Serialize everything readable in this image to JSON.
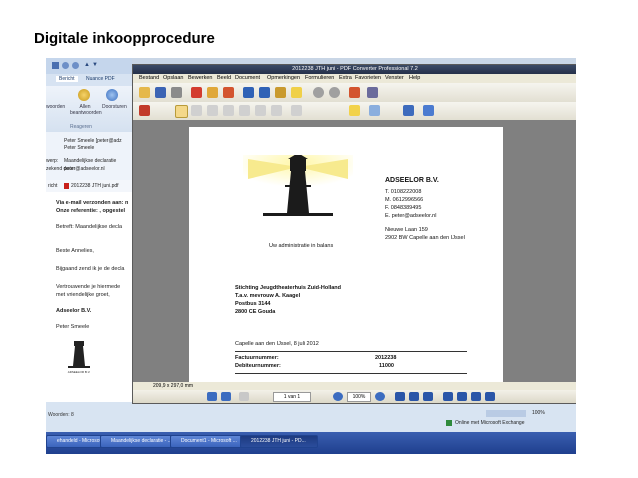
{
  "slide": {
    "title": "Digitale inkoopprocedure"
  },
  "outlook": {
    "tabs": [
      "Bericht",
      "Nuance PDF"
    ],
    "ribbon": {
      "btn1": "Allen beantwoorden",
      "btn2": "Doorsturen",
      "btn0": "woorden",
      "group": "Reageren"
    },
    "header": {
      "from": "Peter Smeele [peter@adz",
      "to": "Peter Smeele",
      "subject_label": "werp:",
      "subject": "Maandelijkse declaratie",
      "sent_label": "zekend door:",
      "sent": "peter@adseelor.nl"
    },
    "attachment": {
      "label": "richt",
      "file": "2012238 JTH juni.pdf"
    },
    "body": {
      "l1": "Via e-mail verzonden aan: n",
      "l2": "Onze referentie: , opgestel",
      "l3": "Betreft: Maandelijkse decla",
      "l4": "Beste Annelies,",
      "l5": "Bijgaand zend ik je de decla",
      "l6": "Vertrouwende je hiermede",
      "l7": "met vriendelijke groet,",
      "l8": "Adseelor B.V.",
      "l9": "Peter Smeele"
    },
    "status": "Woorden: 8"
  },
  "pdf": {
    "title": "2012238 JTH juni - PDF Converter Professional 7.2",
    "menu": [
      "Bestand",
      "Opslaan",
      "Bewerken",
      "Beeld",
      "Document",
      "Opmerkingen",
      "Formulieren",
      "Extra",
      "Favorieten",
      "Venster",
      "Help"
    ],
    "page_info": "209,9 x 297,0 mm",
    "page_nav": "1 van 1",
    "zoom": "100%"
  },
  "document": {
    "logo_caption": "Uw administratie in balans",
    "company": "ADSEELOR B.V.",
    "tel": "T.  0108222008",
    "mob": "M.  0612996566",
    "fax": "F.  0848389495",
    "email": "E.  peter@adseelor.nl",
    "street": "Nieuwe Laan 159",
    "city": "2902 BW  Capelle aan den IJssel",
    "recipient1": "Stichting Jeugdtheaterhuis Zuid-Holland",
    "recipient2": "T.a.v. mevrouw  A.  Kaagel",
    "recipient3": "Postbus 3144",
    "recipient4": "2800 CE Gouda",
    "place_date": "Capelle aan den IJssel, 8 juli 2012",
    "invoice_label": "Factuurnummer:",
    "invoice_value": "2012238",
    "debtor_label": "Debiteurnummer:",
    "debtor_value": "11000"
  },
  "tray": {
    "zoom": "100%",
    "exchange": "Online met Microsoft Exchange"
  },
  "taskbar": [
    "ehandeld - Microsoft ...",
    "Maandelijkse declaratie - ...",
    "Document1 - Microsoft ...",
    "2012238 JTH juni - PD..."
  ]
}
